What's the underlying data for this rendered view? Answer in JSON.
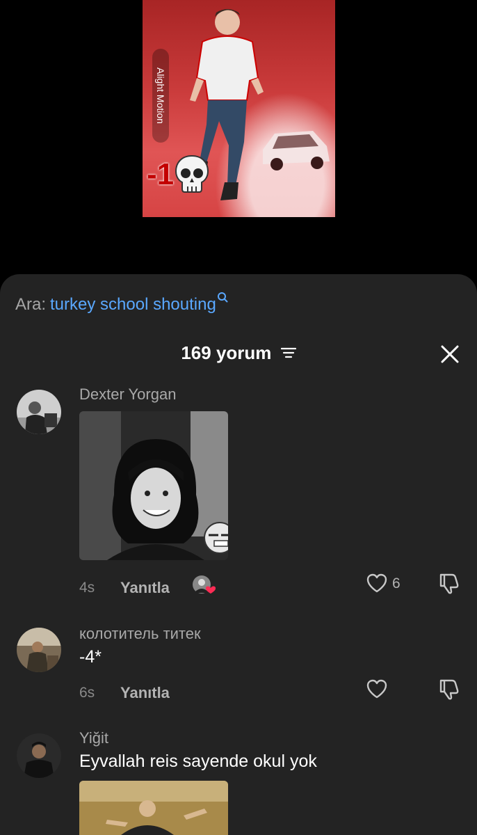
{
  "video": {
    "watermark": "Alight Motion",
    "overlay_text": "-1",
    "overlay_icon": "skull-emoji",
    "accent": "#c93a3a"
  },
  "search": {
    "prefix": "Ara:",
    "term": "turkey school shouting",
    "icon": "search-icon",
    "term_color": "#5aa8ff"
  },
  "header": {
    "title": "169 yorum",
    "filter_icon": "filter-icon",
    "close_icon": "close-icon"
  },
  "comments": [
    {
      "username": "Dexter Yorgan",
      "text": "",
      "has_image": true,
      "time": "4s",
      "reply_label": "Yanıtla",
      "likes": "6",
      "creator_liked": true
    },
    {
      "username": "колотитель титек",
      "text": "-4*",
      "has_image": false,
      "time": "6s",
      "reply_label": "Yanıtla",
      "likes": ""
    },
    {
      "username": "Yiğit",
      "text": "Eyvallah reis sayende okul yok",
      "has_image": true
    }
  ],
  "colors": {
    "sheet_bg": "#232323",
    "username": "#a9a9a9",
    "text": "#ffffff",
    "liked_heart": "#fe2c55"
  }
}
